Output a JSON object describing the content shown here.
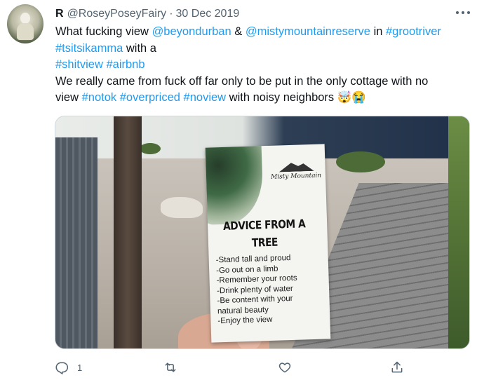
{
  "tweet": {
    "display_name": "R",
    "handle": "@RoseyPoseyFairy",
    "separator": "·",
    "date": "30 Dec 2019",
    "lines": [
      [
        {
          "t": "What fucking view ",
          "link": false
        },
        {
          "t": "@beyondurban",
          "link": true
        },
        {
          "t": " & ",
          "link": false
        },
        {
          "t": "@mistymountainreserve",
          "link": true
        },
        {
          "t": " in ",
          "link": false
        },
        {
          "t": "#grootriver",
          "link": true
        }
      ],
      [
        {
          "t": "#tsitsikamma",
          "link": true
        },
        {
          "t": " with a",
          "link": false
        }
      ],
      [
        {
          "t": "#shitview",
          "link": true
        },
        {
          "t": " ",
          "link": false
        },
        {
          "t": "#airbnb",
          "link": true
        }
      ],
      [
        {
          "t": "We really came from fuck off far only to be put in the only cottage with no",
          "link": false
        }
      ],
      [
        {
          "t": "view ",
          "link": false
        },
        {
          "t": "#notok",
          "link": true
        },
        {
          "t": " ",
          "link": false
        },
        {
          "t": "#overpriced",
          "link": true
        },
        {
          "t": " ",
          "link": false
        },
        {
          "t": "#noview",
          "link": true
        },
        {
          "t": " with noisy neighbors ",
          "link": false
        },
        {
          "t": "🤯😭",
          "link": false
        }
      ]
    ]
  },
  "photo_card": {
    "logo_text": "Misty Mountain",
    "heading": "ADVICE FROM A TREE",
    "items": [
      "-Stand tall and proud",
      "-Go out on a limb",
      "-Remember your roots",
      "-Drink plenty of water",
      "-Be content with your",
      " natural beauty",
      "-Enjoy the view"
    ]
  },
  "actions": {
    "reply_count": "1",
    "icons": [
      "reply-icon",
      "retweet-icon",
      "like-icon",
      "share-icon"
    ]
  },
  "colors": {
    "link": "#1d9bf0",
    "text": "#0f1419",
    "muted": "#536471"
  }
}
